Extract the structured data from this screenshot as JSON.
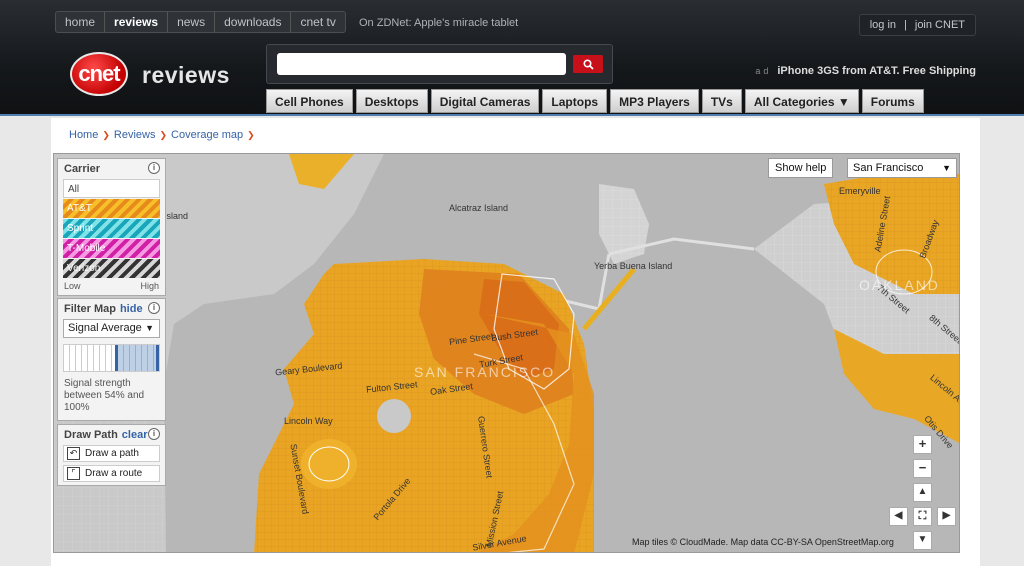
{
  "topnav": [
    "home",
    "reviews",
    "news",
    "downloads",
    "cnet tv"
  ],
  "zdnet": "On ZDNet: Apple's miracle tablet",
  "account": {
    "login": "log in",
    "sep": "|",
    "join": "join CNET"
  },
  "logo": "cnet",
  "brand": "reviews",
  "ad": {
    "tag": "ad",
    "text": "iPhone 3GS from AT&T. Free Shipping"
  },
  "categories": [
    "Cell Phones",
    "Desktops",
    "Digital Cameras",
    "Laptops",
    "MP3 Players",
    "TVs",
    "All Categories ▼",
    "Forums"
  ],
  "breadcrumb": [
    "Home",
    "Reviews",
    "Coverage map"
  ],
  "map": {
    "show_help": "Show help",
    "city": "San Francisco",
    "labels": [
      "Alcatraz Island",
      "Island",
      "Yerba Buena Island",
      "Emeryville",
      "Adeline Street",
      "Broadway",
      "7th Street",
      "8th Street",
      "Lincoln Ave",
      "OAKLAND",
      "Pine Street",
      "Bush Street",
      "Turk Street",
      "Geary Boulevard",
      "Fulton Street",
      "Oak Street",
      "Lincoln Way",
      "Sunset Boulevard",
      "Portola Drive",
      "Guerrero Street",
      "Mission Street",
      "Silver Avenue",
      "SAN FRANCISCO",
      "Otis Drive"
    ],
    "attribution": "Map tiles © CloudMade. Map data CC-BY-SA OpenStreetMap.org"
  },
  "carrier_panel": {
    "title": "Carrier",
    "items": [
      "All",
      "AT&T",
      "Sprint",
      "T-Mobile",
      "Verizon"
    ],
    "low": "Low",
    "high": "High"
  },
  "filter_panel": {
    "title": "Filter Map",
    "hide": "hide",
    "mode": "Signal Average",
    "description": "Signal strength between 54% and 100%",
    "range_min_percent": 54,
    "range_max_percent": 100
  },
  "path_panel": {
    "title": "Draw Path",
    "clear": "clear",
    "buttons": [
      "Draw a path",
      "Draw a route"
    ]
  },
  "controls": {
    "zoom_in": "+",
    "zoom_out": "−",
    "up": "▲",
    "down": "▼",
    "left": "◀",
    "right": "▶",
    "center": "⛶"
  }
}
